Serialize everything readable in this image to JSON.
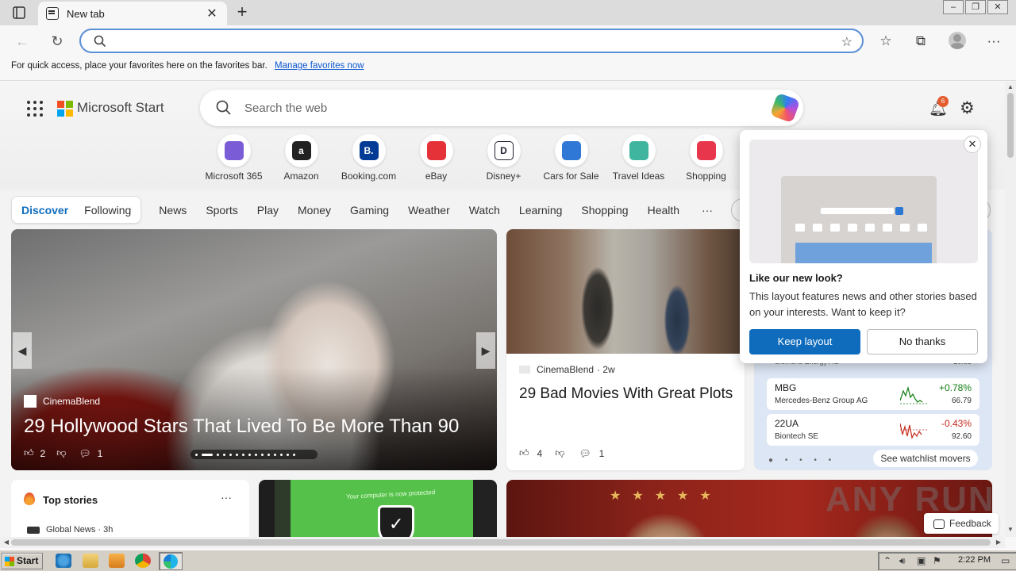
{
  "browser": {
    "tab_title": "New tab",
    "address_value": "",
    "favbar_text": "For quick access, place your favorites here on the favorites bar.",
    "favbar_link": "Manage favorites now"
  },
  "header": {
    "brand": "Microsoft Start",
    "search_placeholder": "Search the web",
    "notification_count": "6"
  },
  "quick_links": [
    {
      "label": "Microsoft 365",
      "icon": "m365-icon",
      "color": "#7a5cd6",
      "glyph": ""
    },
    {
      "label": "Amazon",
      "icon": "amazon-icon",
      "color": "#222222",
      "glyph": "a"
    },
    {
      "label": "Booking.com",
      "icon": "booking-icon",
      "color": "#003b95",
      "glyph": "B."
    },
    {
      "label": "eBay",
      "icon": "ebay-icon",
      "color": "#e53238",
      "glyph": ""
    },
    {
      "label": "Disney+",
      "icon": "disney-icon",
      "color": "#ffffff",
      "glyph": ""
    },
    {
      "label": "Cars for Sale",
      "icon": "car-icon",
      "color": "#2f78d6",
      "glyph": ""
    },
    {
      "label": "Travel Ideas",
      "icon": "travel-icon",
      "color": "#3fb5a0",
      "glyph": ""
    },
    {
      "label": "Shopping",
      "icon": "shopping-icon",
      "color": "#e8364c",
      "glyph": ""
    }
  ],
  "feed_nav": {
    "toggle": [
      "Discover",
      "Following"
    ],
    "items": [
      "News",
      "Sports",
      "Play",
      "Money",
      "Gaming",
      "Weather",
      "Watch",
      "Learning",
      "Shopping",
      "Health"
    ],
    "more": "···"
  },
  "hero": {
    "source": "CinemaBlend",
    "title": "29 Hollywood Stars That Lived To Be More Than 90",
    "likes": "2",
    "comments": "1"
  },
  "article": {
    "source": "CinemaBlend",
    "age": "· 2w",
    "title": "29 Bad Movies With Great Plots",
    "likes": "4",
    "comments": "1"
  },
  "watchlist": {
    "partial_name": "Siemens Energy AG",
    "partial_price": "29.85",
    "stocks": [
      {
        "symbol": "MBG",
        "name": "Mercedes-Benz Group AG",
        "change": "+0.78%",
        "price": "66.79",
        "color": "#107c10"
      },
      {
        "symbol": "22UA",
        "name": "Biontech SE",
        "change": "-0.43%",
        "price": "92.60",
        "color": "#c42b1c"
      }
    ],
    "link": "See watchlist movers"
  },
  "top_stories": {
    "title": "Top stories",
    "more": "···",
    "source": "Global News · 3h"
  },
  "green_card_text": "Your computer is now protected",
  "popup": {
    "title": "Like our new look?",
    "body": "This layout features news and other stories based on your interests. Want to keep it?",
    "keep": "Keep layout",
    "no": "No thanks"
  },
  "feedback": "Feedback",
  "watermark": "ANY RUN",
  "taskbar": {
    "start": "Start",
    "time": "2:22 PM"
  }
}
